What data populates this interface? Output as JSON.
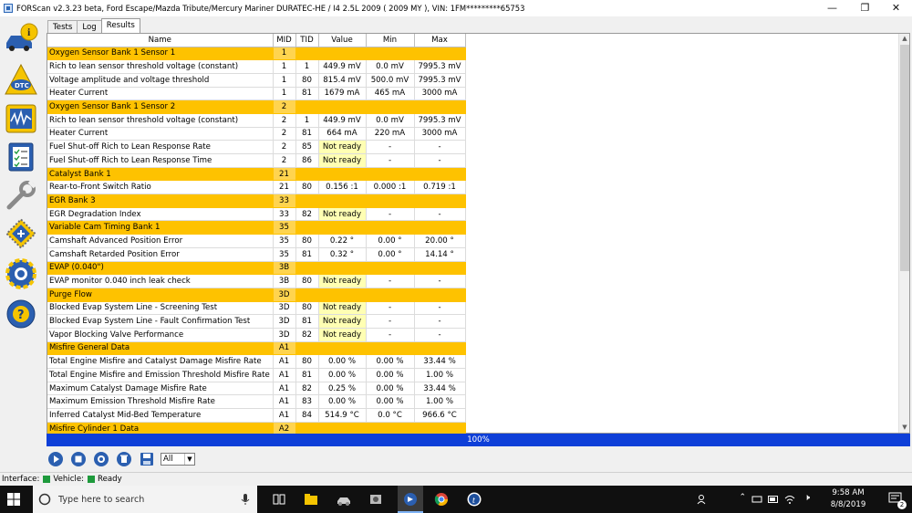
{
  "window": {
    "title": "FORScan v2.3.23 beta, Ford Escape/Mazda Tribute/Mercury Mariner DURATEC-HE / I4 2.5L 2009 ( 2009 MY ), VIN: 1FM*********65753",
    "minimize": "—",
    "maximize": "❐",
    "close": "✕"
  },
  "sidebar": [
    {
      "name": "vehicle-info-icon",
      "label": "i"
    },
    {
      "name": "dtc-icon",
      "label": "DTC"
    },
    {
      "name": "oscilloscope-icon",
      "label": ""
    },
    {
      "name": "checklist-icon",
      "label": ""
    },
    {
      "name": "wrench-icon",
      "label": ""
    },
    {
      "name": "module-config-icon",
      "label": ""
    },
    {
      "name": "settings-gear-icon",
      "label": ""
    },
    {
      "name": "help-icon",
      "label": "?"
    }
  ],
  "tabs": [
    {
      "label": "Tests",
      "active": false
    },
    {
      "label": "Log",
      "active": false
    },
    {
      "label": "Results",
      "active": true
    }
  ],
  "table": {
    "headers": [
      "Name",
      "MID",
      "TID",
      "Value",
      "Min",
      "Max"
    ],
    "rows": [
      {
        "section": true,
        "name": "Oxygen Sensor Bank 1 Sensor 1",
        "mid": "1"
      },
      {
        "name": "Rich to lean sensor threshold voltage (constant)",
        "mid": "1",
        "tid": "1",
        "value": "449.9 mV",
        "min": "0.0 mV",
        "max": "7995.3 mV"
      },
      {
        "name": "Voltage amplitude and voltage threshold",
        "mid": "1",
        "tid": "80",
        "value": "815.4 mV",
        "min": "500.0 mV",
        "max": "7995.3 mV"
      },
      {
        "name": "Heater Current",
        "mid": "1",
        "tid": "81",
        "value": "1679 mA",
        "min": "465 mA",
        "max": "3000 mA"
      },
      {
        "section": true,
        "name": "Oxygen Sensor Bank 1 Sensor 2",
        "mid": "2"
      },
      {
        "name": "Rich to lean sensor threshold voltage (constant)",
        "mid": "2",
        "tid": "1",
        "value": "449.9 mV",
        "min": "0.0 mV",
        "max": "7995.3 mV"
      },
      {
        "name": "Heater Current",
        "mid": "2",
        "tid": "81",
        "value": "664 mA",
        "min": "220 mA",
        "max": "3000 mA"
      },
      {
        "name": "Fuel Shut-off Rich to Lean Response Rate",
        "mid": "2",
        "tid": "85",
        "value": "Not ready",
        "notready": true,
        "min": "-",
        "max": "-"
      },
      {
        "name": "Fuel Shut-off Rich to Lean Response Time",
        "mid": "2",
        "tid": "86",
        "value": "Not ready",
        "notready": true,
        "min": "-",
        "max": "-"
      },
      {
        "section": true,
        "name": "Catalyst Bank 1",
        "mid": "21"
      },
      {
        "name": "Rear-to-Front Switch Ratio",
        "mid": "21",
        "tid": "80",
        "value": "0.156 :1",
        "min": "0.000 :1",
        "max": "0.719 :1"
      },
      {
        "section": true,
        "name": "EGR Bank 3",
        "mid": "33"
      },
      {
        "name": "EGR Degradation Index",
        "mid": "33",
        "tid": "82",
        "value": "Not ready",
        "notready": true,
        "min": "-",
        "max": "-"
      },
      {
        "section": true,
        "name": "Variable Cam Timing Bank 1",
        "mid": "35"
      },
      {
        "name": "Camshaft Advanced Position Error",
        "mid": "35",
        "tid": "80",
        "value": "0.22 °",
        "min": "0.00 °",
        "max": "20.00 °"
      },
      {
        "name": "Camshaft Retarded Position Error",
        "mid": "35",
        "tid": "81",
        "value": "0.32 °",
        "min": "0.00 °",
        "max": "14.14 °"
      },
      {
        "section": true,
        "name": "EVAP (0.040\")",
        "mid": "3B"
      },
      {
        "name": "EVAP monitor 0.040 inch leak check",
        "mid": "3B",
        "tid": "80",
        "value": "Not ready",
        "notready": true,
        "min": "-",
        "max": "-"
      },
      {
        "section": true,
        "name": "Purge Flow",
        "mid": "3D"
      },
      {
        "name": "Blocked Evap System Line - Screening Test",
        "mid": "3D",
        "tid": "80",
        "value": "Not ready",
        "notready": true,
        "min": "-",
        "max": "-"
      },
      {
        "name": "Blocked Evap System Line - Fault Confirmation Test",
        "mid": "3D",
        "tid": "81",
        "value": "Not ready",
        "notready": true,
        "min": "-",
        "max": "-"
      },
      {
        "name": "Vapor Blocking Valve Performance",
        "mid": "3D",
        "tid": "82",
        "value": "Not ready",
        "notready": true,
        "min": "-",
        "max": "-"
      },
      {
        "section": true,
        "name": "Misfire General Data",
        "mid": "A1"
      },
      {
        "name": "Total Engine Misfire and Catalyst Damage Misfire Rate",
        "mid": "A1",
        "tid": "80",
        "value": "0.00 %",
        "min": "0.00 %",
        "max": "33.44 %"
      },
      {
        "name": "Total Engine Misfire and Emission Threshold Misfire Rate",
        "mid": "A1",
        "tid": "81",
        "value": "0.00 %",
        "min": "0.00 %",
        "max": "1.00 %"
      },
      {
        "name": "Maximum Catalyst Damage Misfire Rate",
        "mid": "A1",
        "tid": "82",
        "value": "0.25 %",
        "min": "0.00 %",
        "max": "33.44 %"
      },
      {
        "name": "Maximum Emission Threshold Misfire Rate",
        "mid": "A1",
        "tid": "83",
        "value": "0.00 %",
        "min": "0.00 %",
        "max": "1.00 %"
      },
      {
        "name": "Inferred Catalyst Mid-Bed Temperature",
        "mid": "A1",
        "tid": "84",
        "value": "514.9 °C",
        "min": "0.0 °C",
        "max": "966.6 °C"
      },
      {
        "section": true,
        "name": "Misfire Cylinder 1 Data",
        "mid": "A2"
      }
    ]
  },
  "progress": {
    "label": "100%",
    "fraction": 1.0
  },
  "toolbar": {
    "buttons": [
      "play-icon",
      "stop-icon",
      "record-icon",
      "clear-icon",
      "save-icon"
    ],
    "filter_value": "All"
  },
  "status": {
    "interface_label": "Interface:",
    "vehicle_label": "Vehicle:",
    "state_label": "Ready"
  },
  "taskbar": {
    "search_placeholder": "Type here to search",
    "time": "9:58 AM",
    "date": "8/8/2019",
    "notification_count": "2"
  },
  "colors": {
    "section": "#fec200",
    "not_ready": "#ffffb3",
    "progress": "#0e3fd8",
    "status_ok": "#1e9a3c"
  }
}
